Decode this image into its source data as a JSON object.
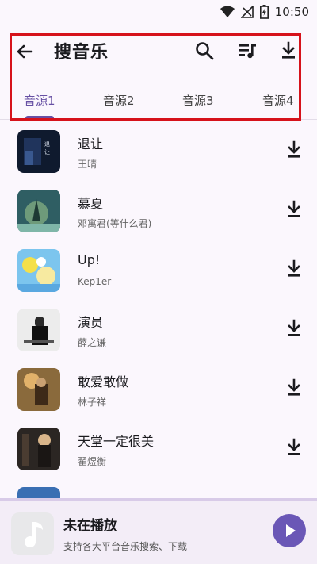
{
  "status_bar": {
    "time": "10:50"
  },
  "app_bar": {
    "title": "搜音乐"
  },
  "tabs": [
    {
      "label": "音源1",
      "active": true
    },
    {
      "label": "音源2",
      "active": false
    },
    {
      "label": "音源3",
      "active": false
    },
    {
      "label": "音源4",
      "active": false
    }
  ],
  "songs": [
    {
      "title": "退让",
      "artist": "王晴"
    },
    {
      "title": "慕夏",
      "artist": "邓寓君(等什么君)"
    },
    {
      "title": "Up!",
      "artist": "Kep1er"
    },
    {
      "title": "演员",
      "artist": "薛之谦"
    },
    {
      "title": "敢爱敢做",
      "artist": "林子祥"
    },
    {
      "title": "天堂一定很美",
      "artist": "翟煜衡"
    }
  ],
  "mini_player": {
    "title": "未在播放",
    "subtitle": "支持各大平台音乐搜索、下载"
  },
  "colors": {
    "accent": "#6750a4",
    "highlight_border": "#d6121b",
    "background": "#fbf7fd"
  },
  "icons": [
    "wifi-icon",
    "signal-off-icon",
    "battery-charging-icon",
    "back-arrow-icon",
    "search-icon",
    "playlist-icon",
    "download-icon",
    "music-note-icon",
    "play-icon"
  ]
}
